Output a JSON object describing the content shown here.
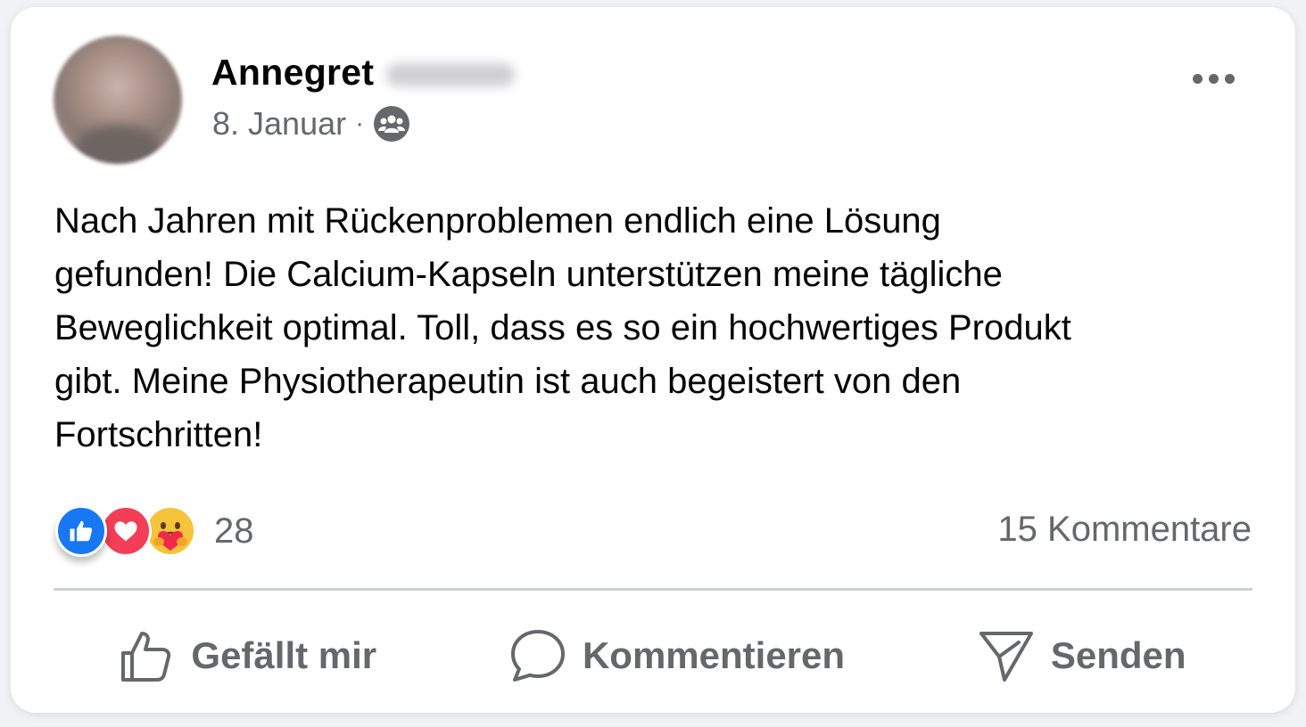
{
  "post": {
    "author_first_name": "Annegret",
    "date": "8. Januar",
    "meta_separator": "·",
    "audience_icon": "friends-audience-icon",
    "text": "Nach Jahren mit Rückenproblemen endlich eine Lösung\ngefunden! Die Calcium-Kapseln unterstützen meine tägliche\nBeweglichkeit optimal. Toll, dass es so ein hochwertiges Produkt\ngibt. Meine Physiotherapeutin ist auch begeistert von den\nFortschritten!"
  },
  "reactions": {
    "types": [
      "like-reaction-icon",
      "love-reaction-icon",
      "care-reaction-icon"
    ],
    "count": "28"
  },
  "comments": {
    "label": "15 Kommentare"
  },
  "actions": {
    "like_label": "Gefällt mir",
    "comment_label": "Kommentieren",
    "share_label": "Senden"
  },
  "colors": {
    "like_blue": "#1877f2",
    "love_red": "#f33e58",
    "care_yellow": "#f7c33b",
    "secondary_text": "#65676b",
    "primary_text": "#050505"
  }
}
